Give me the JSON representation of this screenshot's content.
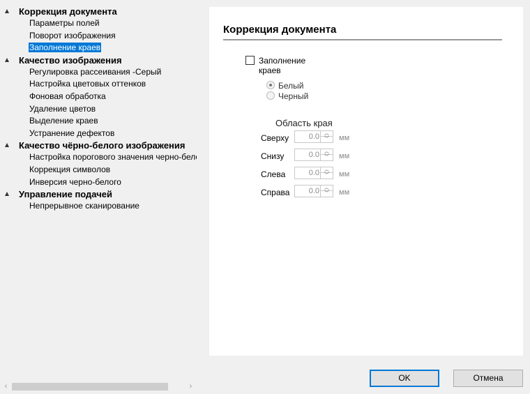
{
  "tree": {
    "groups": [
      {
        "label": "Коррекция документа",
        "items": [
          "Параметры полей",
          "Поворот изображения",
          "Заполнение краев"
        ]
      },
      {
        "label": "Качество изображения",
        "items": [
          "Регулировка рассеивания -Серый",
          "Настройка цветовых оттенков",
          "Фоновая обработка",
          "Удаление цветов",
          "Выделение краев",
          "Устранение дефектов"
        ]
      },
      {
        "label": "Качество чёрно-белого изображения",
        "items": [
          "Настройка порогового значения черно-белого",
          "Коррекция символов",
          "Инверсия черно-белого"
        ]
      },
      {
        "label": "Управление подачей",
        "items": [
          "Непрерывное сканирование"
        ]
      }
    ],
    "selected_item": "Заполнение краев"
  },
  "scrollbar": {
    "left_arrow": "‹",
    "right_arrow": "›"
  },
  "panel": {
    "title": "Коррекция документа",
    "checkbox_label": "Заполнение краев",
    "checkbox_checked": false,
    "radio_white": "Белый",
    "radio_black": "Черный",
    "selected_radio": "Белый",
    "area_title": "Область края",
    "fields": [
      {
        "label": "Сверху",
        "value": "0.0",
        "unit": "мм"
      },
      {
        "label": "Снизу",
        "value": "0.0",
        "unit": "мм"
      },
      {
        "label": "Слева",
        "value": "0.0",
        "unit": "мм"
      },
      {
        "label": "Справа",
        "value": "0.0",
        "unit": "мм"
      }
    ]
  },
  "buttons": {
    "ok": "OK",
    "cancel": "Отмена"
  },
  "colors": {
    "selection": "#0078d7",
    "panel_bg": "#ffffff",
    "window_bg": "#f0f0f0"
  }
}
